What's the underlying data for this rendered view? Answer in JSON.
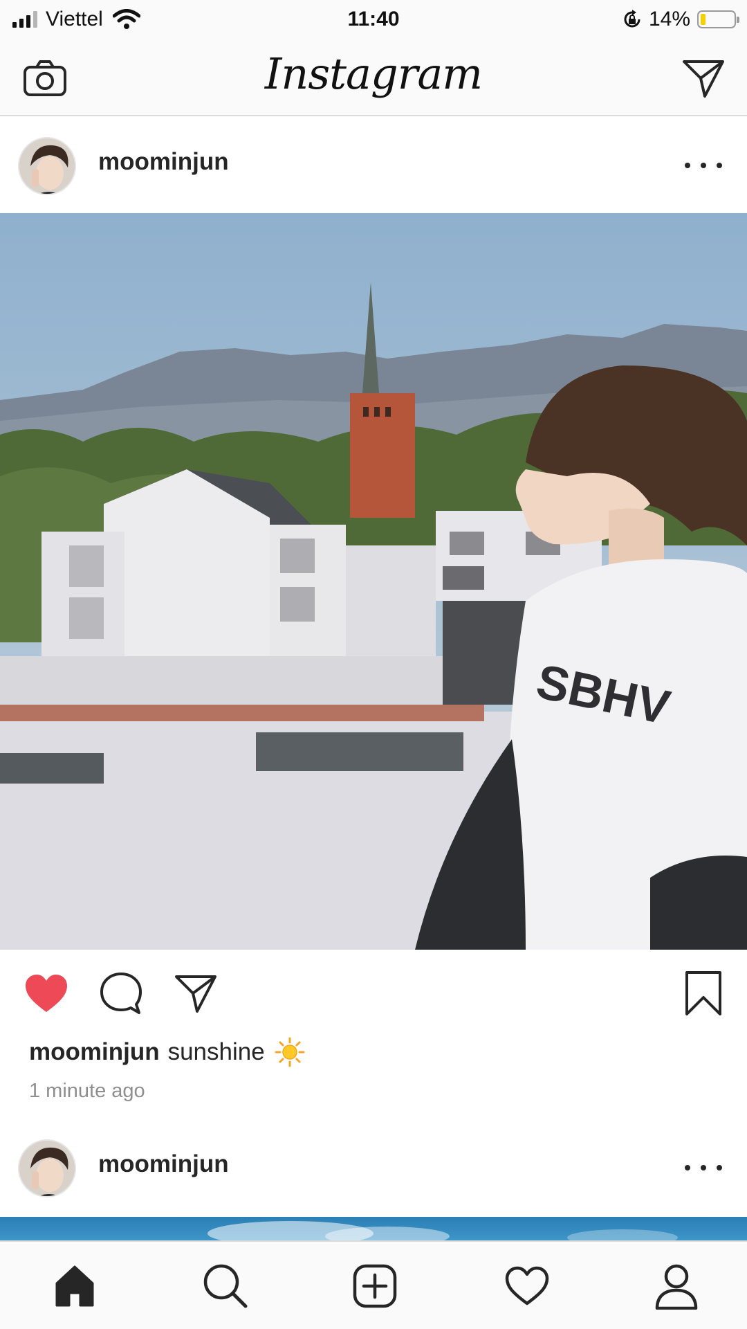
{
  "status_bar": {
    "carrier": "Viettel",
    "time": "11:40",
    "battery_percent": "14%",
    "battery_level": 0.14
  },
  "app": {
    "title": "Instagram"
  },
  "post1": {
    "username": "moominjun",
    "caption_user": "moominjun",
    "caption_text": "sunshine",
    "caption_emoji": "sun-emoji",
    "timestamp": "1 minute ago",
    "liked": true
  },
  "post2": {
    "username": "moominjun"
  },
  "icons": {
    "header_left": "camera-icon",
    "header_right": "direct-message-icon",
    "post_actions": [
      "heart-icon",
      "comment-icon",
      "share-icon",
      "bookmark-icon"
    ],
    "tabs": [
      "home-icon",
      "search-icon",
      "add-post-icon",
      "activity-heart-icon",
      "profile-icon"
    ]
  },
  "colors": {
    "like": "#ed4956",
    "text": "#262626",
    "meta": "#8e8e8e",
    "bar_bg": "#fafafa",
    "divider": "#dbdbdb"
  }
}
